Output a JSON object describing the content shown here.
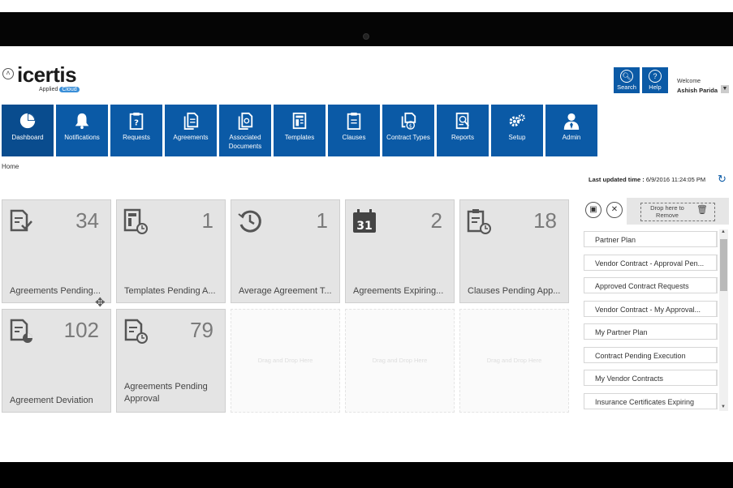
{
  "brand": {
    "name": "icertis",
    "sub": "Applied",
    "cloud": "Cloud"
  },
  "topbar": {
    "search_label": "Search",
    "help_label": "Help",
    "welcome_label": "Welcome",
    "user_name": "Ashish Parida"
  },
  "nav": [
    {
      "label": "Dashboard",
      "icon": "pie-chart-icon"
    },
    {
      "label": "Notifications",
      "icon": "bell-icon"
    },
    {
      "label": "Requests",
      "icon": "clipboard-question-icon"
    },
    {
      "label": "Agreements",
      "icon": "documents-icon"
    },
    {
      "label": "Associated Documents",
      "icon": "associated-documents-icon"
    },
    {
      "label": "Templates",
      "icon": "template-icon"
    },
    {
      "label": "Clauses",
      "icon": "clipboard-icon"
    },
    {
      "label": "Contract Types",
      "icon": "contract-type-icon"
    },
    {
      "label": "Reports",
      "icon": "report-icon"
    },
    {
      "label": "Setup",
      "icon": "gears-icon"
    },
    {
      "label": "Admin",
      "icon": "admin-user-icon"
    }
  ],
  "breadcrumb": "Home",
  "last_updated": {
    "label": "Last updated time :",
    "value": "6/9/2016 11:24:05 PM"
  },
  "tiles": [
    {
      "count": "34",
      "label": "Agreements Pending...",
      "icon": "document-check-icon"
    },
    {
      "count": "1",
      "label": "Templates Pending A...",
      "icon": "template-clock-icon"
    },
    {
      "count": "1",
      "label": "Average Agreement T...",
      "icon": "history-clock-icon"
    },
    {
      "count": "2",
      "label": "Agreements Expiring...",
      "icon": "calendar-31-icon"
    },
    {
      "count": "18",
      "label": "Clauses Pending App...",
      "icon": "clipboard-clock-icon"
    },
    {
      "count": "102",
      "label": "Agreement Deviation",
      "icon": "document-pie-icon"
    },
    {
      "count": "79",
      "label": "Agreements Pending Approval",
      "icon": "document-clock-icon"
    }
  ],
  "empty_tile_text": "Drag and Drop Here",
  "drop_remove": {
    "line1": "Drop here to",
    "line2": "Remove"
  },
  "widget_list": [
    "Partner Plan",
    "Vendor Contract - Approval Pen...",
    "Approved Contract Requests",
    "Vendor Contract - My Approval...",
    "My Partner Plan",
    "Contract Pending Execution",
    "My Vendor Contracts",
    "Insurance Certificates Expiring"
  ]
}
